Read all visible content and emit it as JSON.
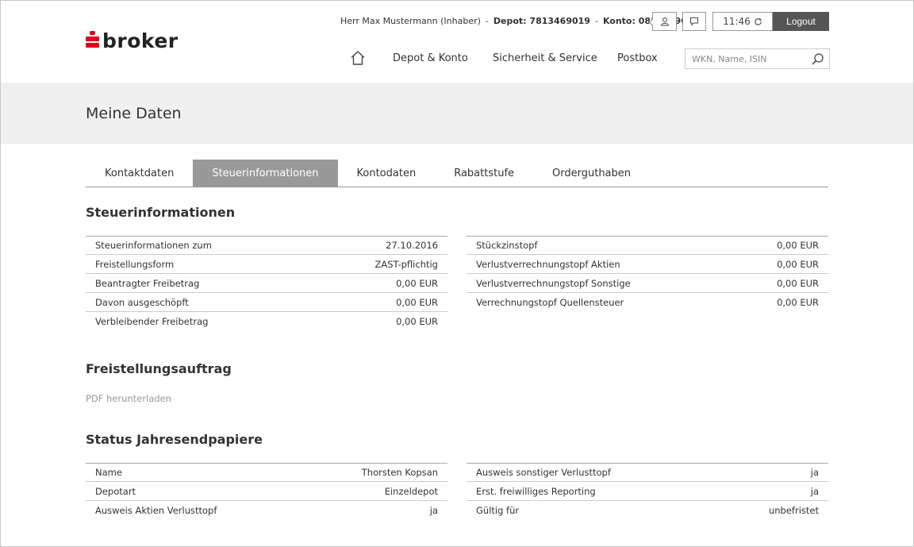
{
  "header": {
    "logo_text": "broker",
    "user_name": "Herr Max Mustermann (Inhaber)",
    "depot": "Depot: 7813469019",
    "konto": "Konto: 0813469014",
    "separator": "-",
    "time": "11:46",
    "logout_label": "Logout"
  },
  "nav": {
    "items": [
      "Depot & Konto",
      "Sicherheit & Service",
      "Postbox"
    ],
    "search_placeholder": "WKN, Name, ISIN"
  },
  "page": {
    "title": "Meine Daten"
  },
  "tabs": [
    {
      "label": "Kontaktdaten",
      "active": false
    },
    {
      "label": "Steuerinformationen",
      "active": true
    },
    {
      "label": "Kontodaten",
      "active": false
    },
    {
      "label": "Rabattstufe",
      "active": false
    },
    {
      "label": "Orderguthaben",
      "active": false
    }
  ],
  "steuer": {
    "title": "Steuerinformationen",
    "left": [
      {
        "label": "Steuerinformationen zum",
        "value": "27.10.2016"
      },
      {
        "label": "Freistellungsform",
        "value": "ZAST-pflichtig"
      },
      {
        "label": "Beantragter Freibetrag",
        "value": "0,00 EUR"
      },
      {
        "label": "Davon ausgeschöpft",
        "value": "0,00 EUR"
      },
      {
        "label": "Verbleibender Freibetrag",
        "value": "0,00 EUR"
      }
    ],
    "right": [
      {
        "label": "Stückzinstopf",
        "value": "0,00 EUR"
      },
      {
        "label": "Verlustverrechnungstopf Aktien",
        "value": "0,00 EUR"
      },
      {
        "label": "Verlustverrechnungstopf Sonstige",
        "value": "0,00 EUR"
      },
      {
        "label": "Verrechnungstopf Quellensteuer",
        "value": "0,00 EUR"
      }
    ]
  },
  "freistellung": {
    "title": "Freistellungsauftrag",
    "pdf_link": "PDF herunterladen"
  },
  "status": {
    "title": "Status Jahresendpapiere",
    "left": [
      {
        "label": "Name",
        "value": "Thorsten Kopsan"
      },
      {
        "label": "Depotart",
        "value": "Einzeldepot"
      },
      {
        "label": "Ausweis Aktien Verlusttopf",
        "value": "ja"
      }
    ],
    "right": [
      {
        "label": "Ausweis sonstiger Verlusttopf",
        "value": "ja"
      },
      {
        "label": "Erst. freiwilliges Reporting",
        "value": "ja"
      },
      {
        "label": "Gültig für",
        "value": "unbefristet"
      }
    ]
  },
  "colors": {
    "brand_red": "#e2001a",
    "tab_active": "#999999",
    "logout_bg": "#555555",
    "band_bg": "#f0f0f0"
  }
}
